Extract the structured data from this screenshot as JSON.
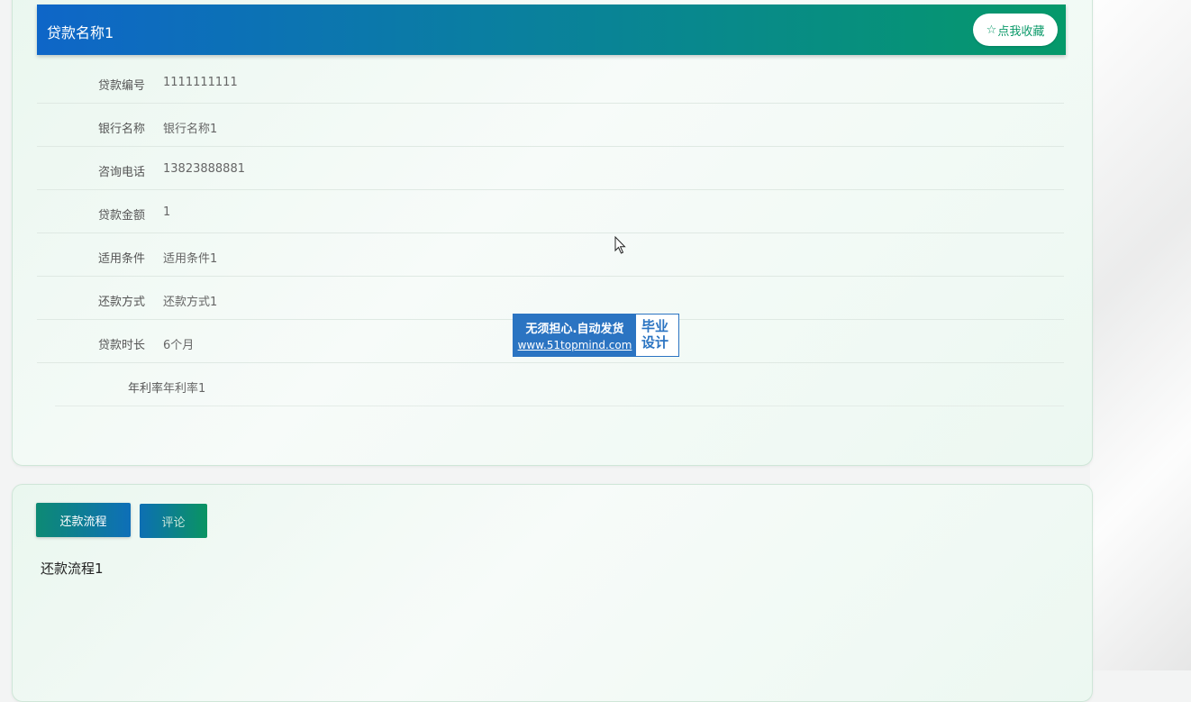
{
  "loan": {
    "title": "贷款名称1",
    "favorite_label": "点我收藏",
    "favorite_icon": "star-outline-icon",
    "fields": [
      {
        "label": "贷款编号",
        "value": "1111111111"
      },
      {
        "label": "银行名称",
        "value": "银行名称1"
      },
      {
        "label": "咨询电话",
        "value": "13823888881"
      },
      {
        "label": "贷款金额",
        "value": "1"
      },
      {
        "label": "适用条件",
        "value": "适用条件1"
      },
      {
        "label": "还款方式",
        "value": "还款方式1"
      },
      {
        "label": "贷款时长",
        "value": "6个月"
      },
      {
        "label": "年利率",
        "value": "年利率1"
      }
    ]
  },
  "watermark": {
    "line1": "无须担心.自动发货",
    "line2": "www.51topmind.com",
    "side1": "毕业",
    "side2": "设计"
  },
  "tabs": {
    "items": [
      {
        "label": "还款流程"
      },
      {
        "label": "评论"
      }
    ],
    "active_index": 0,
    "content": "还款流程1"
  },
  "colors": {
    "header_gradient_start": "#0e66c8",
    "header_gradient_end": "#05996a",
    "accent_green": "#0c9a6a",
    "watermark_blue": "#2b74c2"
  }
}
